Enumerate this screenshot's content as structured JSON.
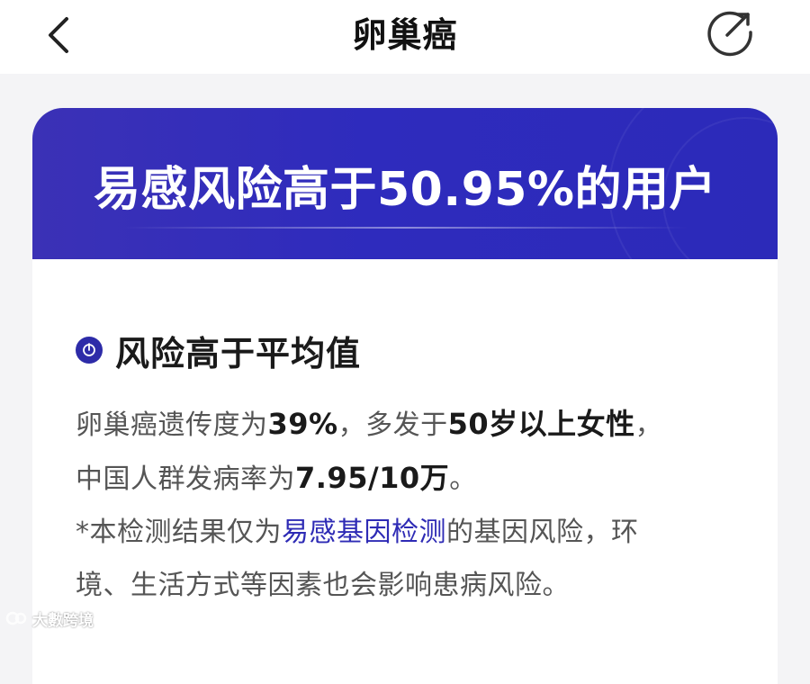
{
  "header": {
    "title": "卵巢癌",
    "back_icon": "chevron-left-icon",
    "refresh_icon": "refresh-icon"
  },
  "banner": {
    "title": "易感风险高于50.95%的用户",
    "color": "#2e2bbd"
  },
  "section": {
    "icon": "bulb-icon",
    "title": "风险高于平均值"
  },
  "description": {
    "line1_a": "卵巢癌遗传度为",
    "line1_b": "39%",
    "line1_c": "，多发于",
    "line1_d": "50岁以上女性",
    "line1_e": "，",
    "line2_a": "中国人群发病率为",
    "line2_b": "7.95/10万",
    "line2_c": "。",
    "note_a": "*本检测结果仅为",
    "note_link": "易感基因检测",
    "note_b": "的基因风险，环",
    "note_c": "境、生活方式等因素也会影响患病风险。"
  },
  "watermark": {
    "text": "大數跨境"
  }
}
